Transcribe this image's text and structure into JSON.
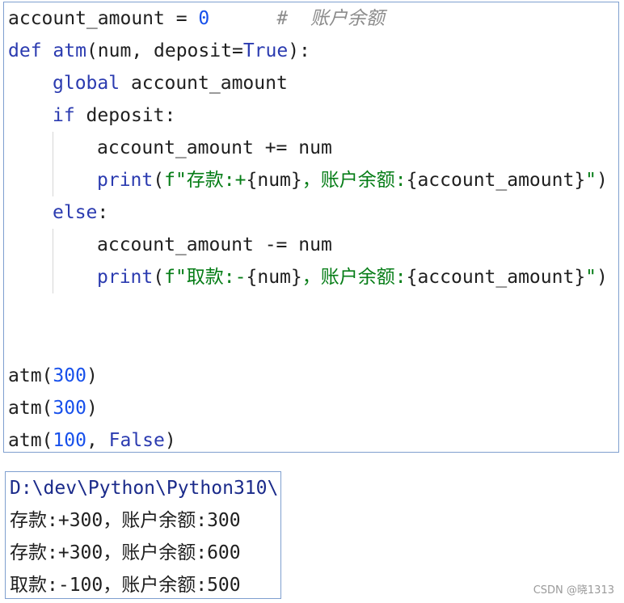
{
  "code": {
    "l1_var": "account_amount",
    "l1_eq": " = ",
    "l1_num": "0",
    "l1_comment": "#  账户余额",
    "l2_def": "def",
    "l2_name": " atm",
    "l2_params": "(num, deposit=",
    "l2_true": "True",
    "l2_end": "):",
    "l3_global": "global",
    "l3_var": " account_amount",
    "l4_if": "if",
    "l4_rest": " deposit:",
    "l5": "account_amount += num",
    "l6_print": "print",
    "l6_open": "(",
    "l6_fmt_a": "f\"存款:+",
    "l6_brace_a": "{num}",
    "l6_fmt_b": "，账户余额:",
    "l6_brace_b": "{account_amount}",
    "l6_fmt_c": "\"",
    "l6_close": ")",
    "l7_else": "else",
    "l7_colon": ":",
    "l8": "account_amount -= num",
    "l9_print": "print",
    "l9_open": "(",
    "l9_fmt_a": "f\"取款:-",
    "l9_brace_a": "{num}",
    "l9_fmt_b": "，账户余额:",
    "l9_brace_b": "{account_amount}",
    "l9_fmt_c": "\"",
    "l9_close": ")",
    "c1_name": "atm(",
    "c1_num": "300",
    "c1_end": ")",
    "c2_name": "atm(",
    "c2_num": "300",
    "c2_end": ")",
    "c3_name": "atm(",
    "c3_num": "100",
    "c3_mid": ", ",
    "c3_false": "False",
    "c3_end": ")"
  },
  "output": {
    "path": "D:\\dev\\Python\\Python310\\",
    "lines": [
      "存款:+300，账户余额:300",
      "存款:+300，账户余额:600",
      "取款:-100，账户余额:500"
    ]
  },
  "watermark": "CSDN @晓1313"
}
